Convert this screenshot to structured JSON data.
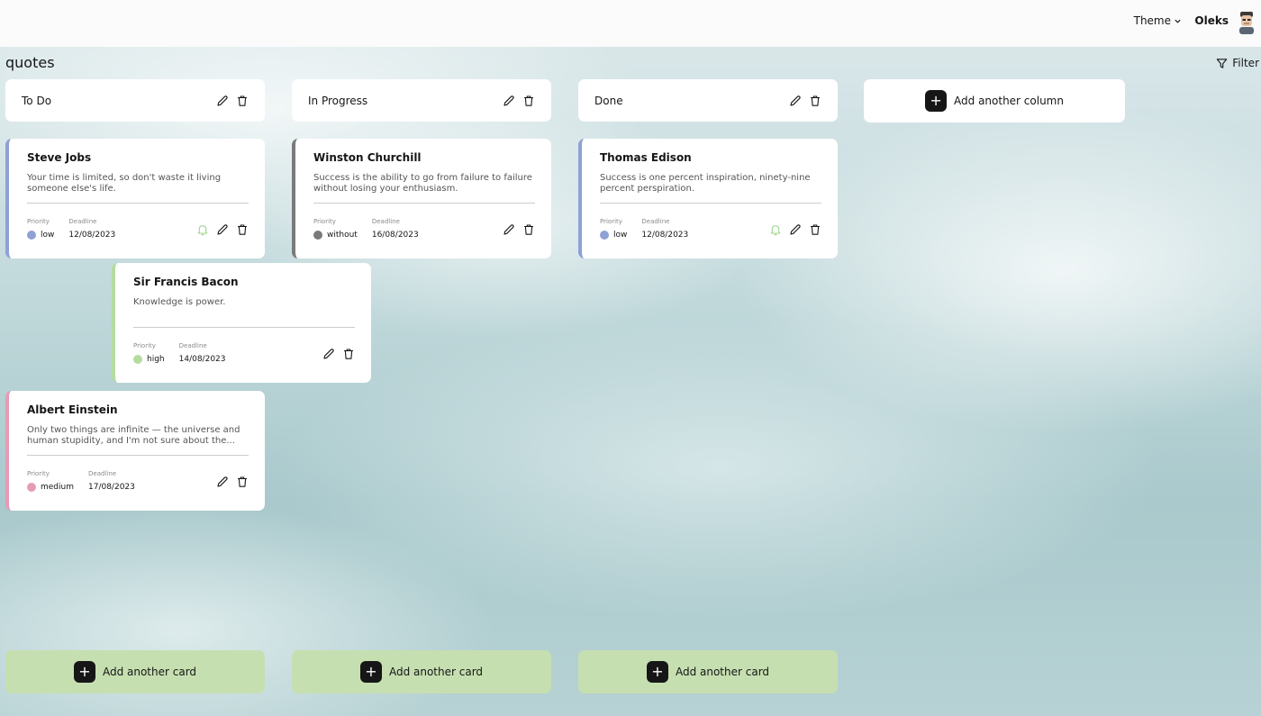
{
  "topbar": {
    "theme_label": "Theme",
    "user_name": "Oleks"
  },
  "board": {
    "title": "quotes",
    "filter_label": "Filter",
    "add_column_label": "Add another column",
    "add_card_label": "Add another card"
  },
  "columns": [
    {
      "title": "To Do"
    },
    {
      "title": "In Progress"
    },
    {
      "title": "Done"
    }
  ],
  "cards": [
    {
      "title": "Steve Jobs",
      "description": "Your time is limited, so don't waste it living someone else's life.",
      "priority_label": "Priority",
      "deadline_label": "Deadline",
      "priority": "low",
      "deadline": "12/08/2023",
      "color": "#8fa1d4",
      "bell": true
    },
    {
      "title": "Winston Churchill",
      "description": "Success is the ability to go from failure to failure without losing your enthusiasm.",
      "priority_label": "Priority",
      "deadline_label": "Deadline",
      "priority": "without",
      "deadline": "16/08/2023",
      "color": "#7a7a7a",
      "bell": false
    },
    {
      "title": "Thomas Edison",
      "description": "Success is one percent inspiration, ninety-nine percent perspiration.",
      "priority_label": "Priority",
      "deadline_label": "Deadline",
      "priority": "low",
      "deadline": "12/08/2023",
      "color": "#8fa1d4",
      "bell": true
    },
    {
      "title": "Sir Francis Bacon",
      "description": "Knowledge is power.",
      "priority_label": "Priority",
      "deadline_label": "Deadline",
      "priority": "high",
      "deadline": "14/08/2023",
      "color": "#b6dba0",
      "bell": false
    },
    {
      "title": "Albert Einstein",
      "description": "Only two things are infinite — the universe and human stupidity, and I'm not sure about the...",
      "priority_label": "Priority",
      "deadline_label": "Deadline",
      "priority": "medium",
      "deadline": "17/08/2023",
      "color": "#e79bb5",
      "bell": false
    }
  ],
  "colors": {
    "accent_dark": "#161616",
    "add_card_bg": "#c6dfb0",
    "bell_green": "#9dd48f"
  },
  "icons": [
    "chevron-down-icon",
    "avatar",
    "filter-icon",
    "edit-icon",
    "trash-icon",
    "bell-icon",
    "plus-icon"
  ]
}
